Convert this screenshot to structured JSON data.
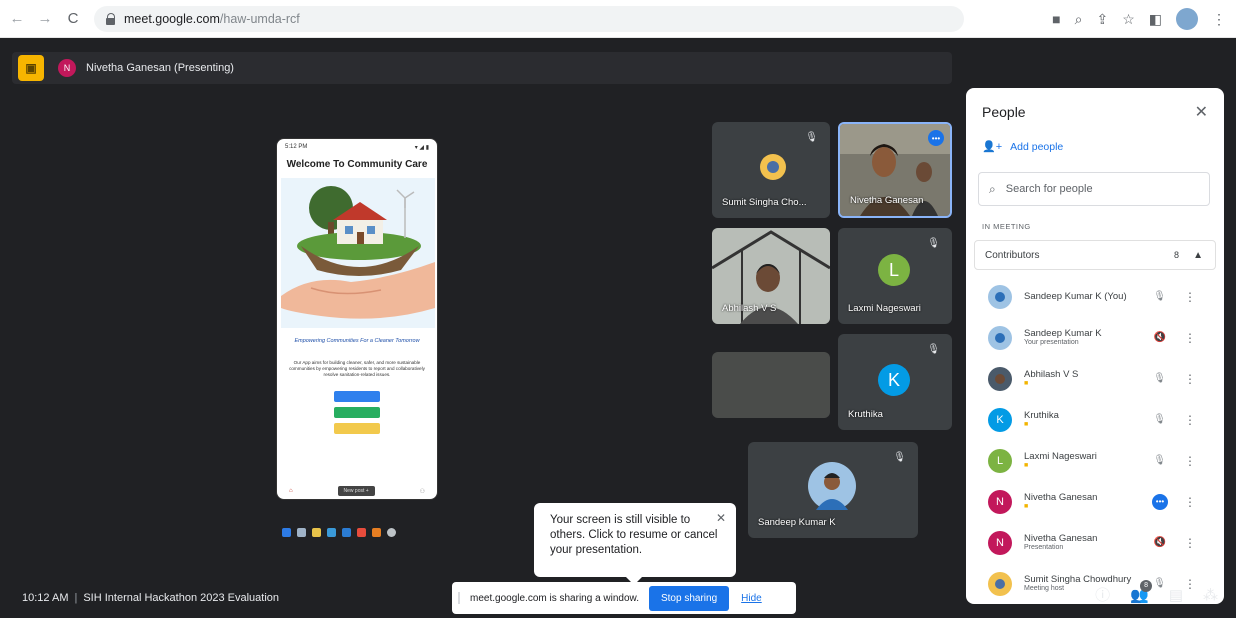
{
  "browser": {
    "url_host": "meet.google.com",
    "url_path": "/haw-umda-rcf"
  },
  "meet": {
    "presenter_label": "Nivetha Ganesan (Presenting)",
    "presenter_initial": "N",
    "meeting_time": "10:12 AM",
    "meeting_title": "SIH Internal Hackathon 2023 Evaluation"
  },
  "phone": {
    "time": "5:12 PM",
    "title": "Welcome To Community Care",
    "tagline": "Empowering Communities For a Cleaner Tomorrow",
    "description": "Our App aims for building cleaner, safer, and more sustainable communities by empowering residents to report and collaboratively resolve sanitation-related issues.",
    "nav_pill": "New post +"
  },
  "tiles": [
    {
      "name": "Sumit Singha Cho..."
    },
    {
      "name": "Nivetha Ganesan"
    },
    {
      "name": "Abhilash V S"
    },
    {
      "name": "Laxmi Nageswari",
      "initial": "L"
    },
    {
      "name": "Kruthika",
      "initial": "K"
    },
    {
      "name": "Sandeep Kumar K"
    }
  ],
  "people_panel": {
    "title": "People",
    "add_people": "Add people",
    "search_placeholder": "Search for people",
    "section": "IN MEETING",
    "group_label": "Contributors",
    "group_count": "8",
    "participants": [
      {
        "name": "Sandeep Kumar K (You)",
        "sub": ""
      },
      {
        "name": "Sandeep Kumar K",
        "sub": "Your presentation"
      },
      {
        "name": "Abhilash V S",
        "sub": ""
      },
      {
        "name": "Kruthika",
        "sub": "",
        "initial": "K"
      },
      {
        "name": "Laxmi Nageswari",
        "sub": "",
        "initial": "L"
      },
      {
        "name": "Nivetha Ganesan",
        "sub": "",
        "initial": "N"
      },
      {
        "name": "Nivetha Ganesan",
        "sub": "Presentation",
        "initial": "N"
      },
      {
        "name": "Sumit Singha Chowdhury",
        "sub": "Meeting host"
      }
    ]
  },
  "popup": {
    "text": "Your screen is still visible to others. Click to resume or cancel your presentation."
  },
  "share_bar": {
    "text": "meet.google.com is sharing a window.",
    "stop": "Stop sharing",
    "hide": "Hide"
  },
  "footer": {
    "people_count": "8"
  },
  "colors": {
    "meet_bg": "#202124",
    "accent": "#1a73e8",
    "present_yellow": "#f7b500"
  }
}
